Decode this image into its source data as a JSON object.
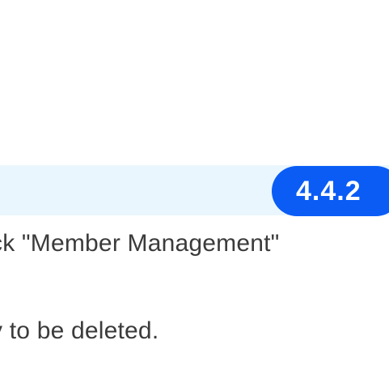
{
  "section": {
    "version": "4.4.2",
    "accent_color": "#0a5cf5",
    "bar_color": "#eaf6fd"
  },
  "content": {
    "line1": "ck \"Member Management\"",
    "line2": "y to be deleted."
  }
}
